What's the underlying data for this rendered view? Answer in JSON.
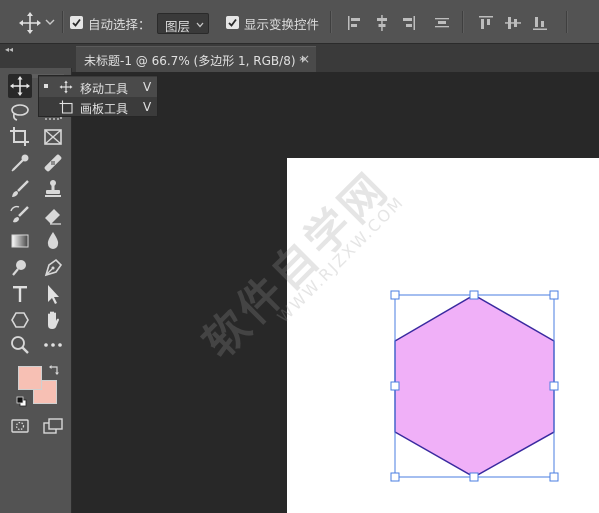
{
  "options_bar": {
    "auto_select_label": "自动选择：",
    "auto_select_checked": true,
    "auto_select_target": "图层",
    "show_transform_label": "显示变换控件",
    "show_transform_checked": true
  },
  "document_tab": {
    "title": "未标题-1 @ 66.7% (多边形 1, RGB/8) *",
    "close": "×"
  },
  "toolbar": {
    "collapse_label": "◂◂",
    "tools_left": [
      "move-tool",
      "lasso-tool",
      "crop-tool",
      "eyedropper-tool",
      "brush-tool",
      "history-brush-tool",
      "gradient-tool",
      "dodge-tool",
      "type-tool",
      "shape-tool",
      "zoom-tool"
    ],
    "tools_right": [
      "marquee-tool",
      "magic-wand-tool",
      "frame-tool",
      "healing-brush-tool",
      "clone-stamp-tool",
      "eraser-tool",
      "blur-tool",
      "pen-tool",
      "path-selection-tool",
      "hand-tool",
      "more-tools"
    ],
    "foreground_color": "#f7c0b4",
    "background_color": "#f7c0b4"
  },
  "flyout": {
    "items": [
      {
        "label": "移动工具",
        "shortcut": "V",
        "selected": true
      },
      {
        "label": "画板工具",
        "shortcut": "V",
        "selected": false
      }
    ]
  },
  "watermark": {
    "text": "软件自学网",
    "url": "WWW.RJZXW.COM"
  },
  "colors": {
    "hexagon_fill": "#f0b0f8",
    "hexagon_stroke": "#3a2aa0",
    "bounding_box": "#4a7ee0",
    "canvas": "#ffffff",
    "workspace": "#282828"
  }
}
